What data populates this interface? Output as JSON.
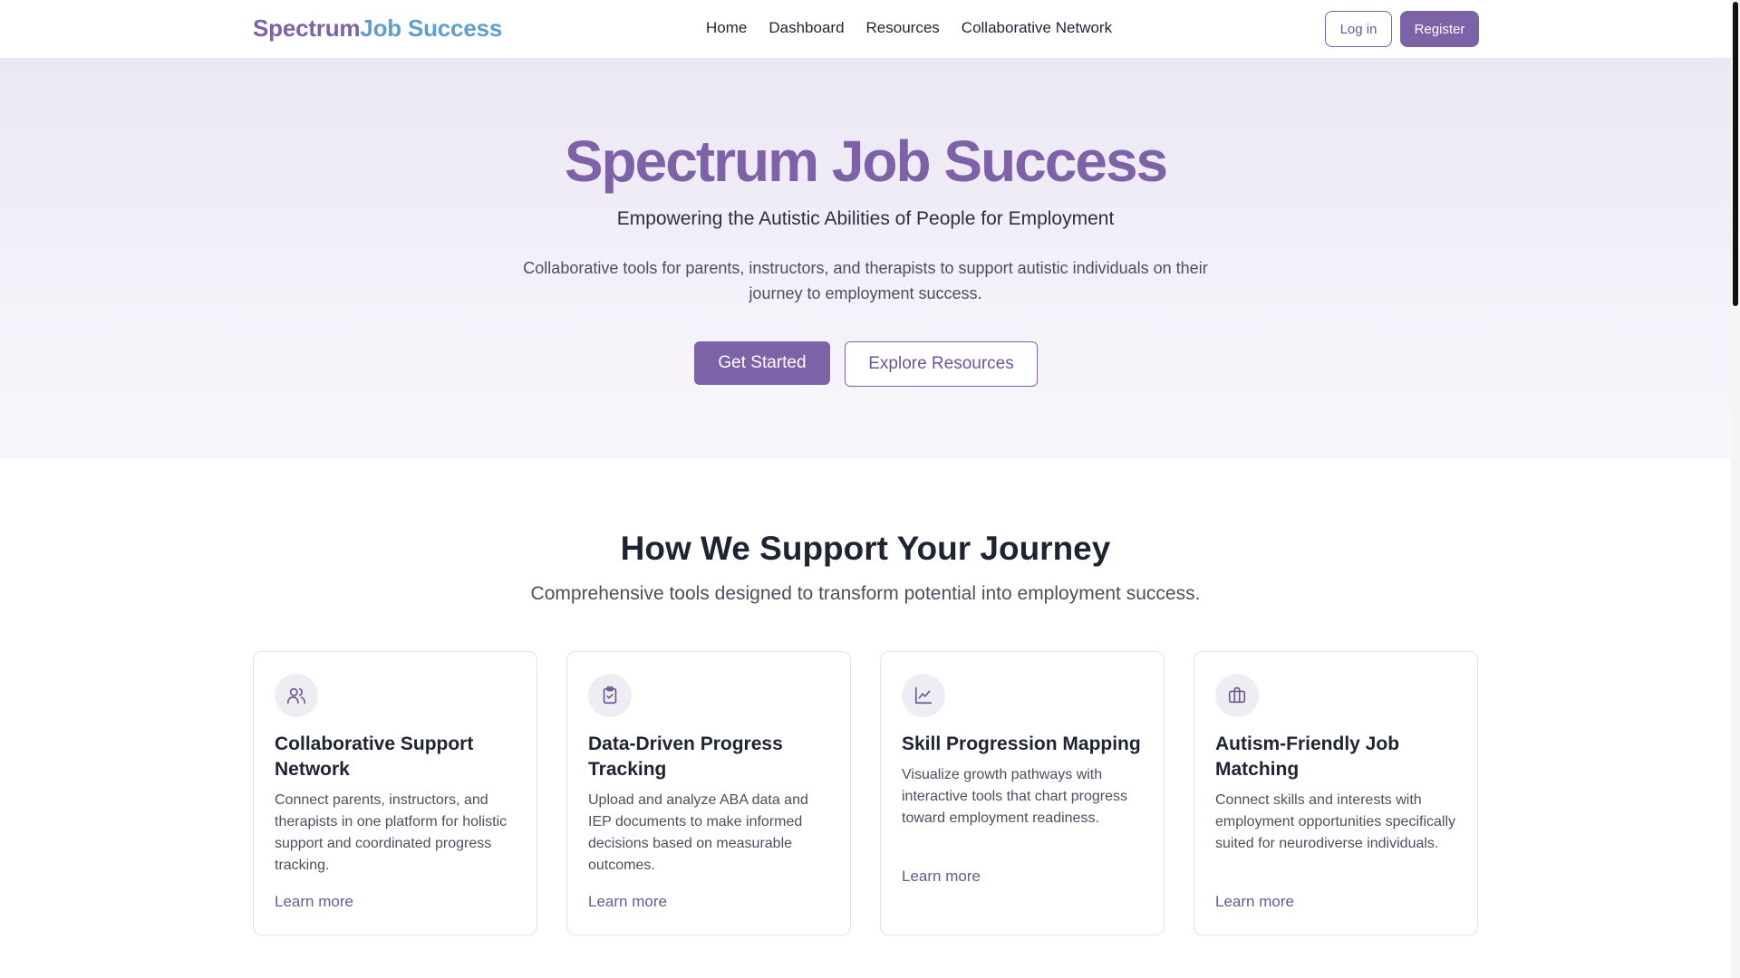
{
  "header": {
    "logo_part1": "Spectrum",
    "logo_part2": "Job Success",
    "nav": [
      "Home",
      "Dashboard",
      "Resources",
      "Collaborative Network"
    ],
    "login_label": "Log in",
    "register_label": "Register"
  },
  "hero": {
    "title": "Spectrum Job Success",
    "subtitle": "Empowering the Autistic Abilities of People for Employment",
    "description": "Collaborative tools for parents, instructors, and therapists to support autistic individuals on their journey to employment success.",
    "primary_cta": "Get Started",
    "secondary_cta": "Explore Resources"
  },
  "features": {
    "title": "How We Support Your Journey",
    "subtitle": "Comprehensive tools designed to transform potential into employment success.",
    "cards": [
      {
        "icon": "users-icon",
        "title": "Collaborative Support Network",
        "description": "Connect parents, instructors, and therapists in one platform for holistic support and coordinated progress tracking.",
        "link": "Learn more"
      },
      {
        "icon": "clipboard-check-icon",
        "title": "Data-Driven Progress Tracking",
        "description": "Upload and analyze ABA data and IEP documents to make informed decisions based on measurable outcomes.",
        "link": "Learn more"
      },
      {
        "icon": "line-chart-icon",
        "title": "Skill Progression Mapping",
        "description": "Visualize growth pathways with interactive tools that chart progress toward employment readiness.",
        "link": "Learn more"
      },
      {
        "icon": "briefcase-icon",
        "title": "Autism-Friendly Job Matching",
        "description": "Connect skills and interests with employment opportunities specifically suited for neurodiverse individuals.",
        "link": "Learn more"
      }
    ]
  },
  "colors": {
    "primary": "#7d62a8",
    "logo_accent": "#5f9fcf",
    "hero_bg": "#ebe7f4"
  }
}
